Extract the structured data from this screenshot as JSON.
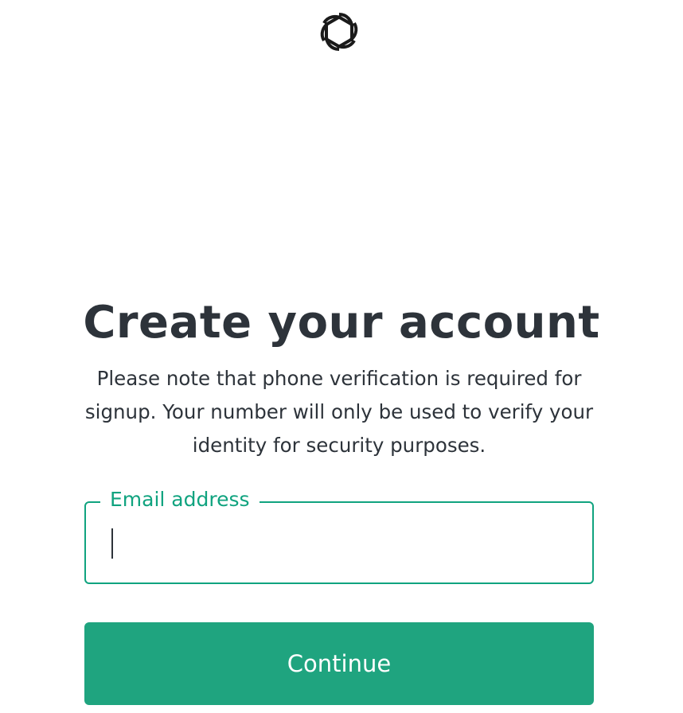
{
  "header": {
    "logo_icon": "openai-logo-icon"
  },
  "main": {
    "title": "Create your account",
    "subtitle": "Please note that phone verification is required for signup. Your number will only be used to verify your identity for security purposes.",
    "email_field": {
      "label": "Email address",
      "value": "",
      "placeholder": ""
    },
    "continue_label": "Continue"
  },
  "colors": {
    "accent": "#10a37f",
    "button": "#1fa47f",
    "text": "#2d333a",
    "background": "#ffffff"
  }
}
